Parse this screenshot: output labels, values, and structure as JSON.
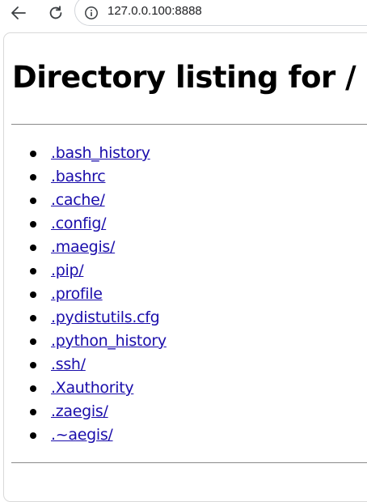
{
  "browser": {
    "url": "127.0.0.100:8888",
    "icons": {
      "back": "arrow-left-icon",
      "reload": "reload-icon",
      "site_info": "info-icon"
    }
  },
  "page": {
    "title": "Directory listing for /",
    "entries": [
      ".bash_history",
      ".bashrc",
      ".cache/",
      ".config/",
      ".maegis/",
      ".pip/",
      ".profile",
      ".pydistutils.cfg",
      ".python_history",
      ".ssh/",
      ".Xauthority",
      ".zaegis/",
      ".~aegis/"
    ]
  },
  "colors": {
    "link": "#1a0dab",
    "text": "#000000",
    "rule": "#8a8a8a"
  }
}
